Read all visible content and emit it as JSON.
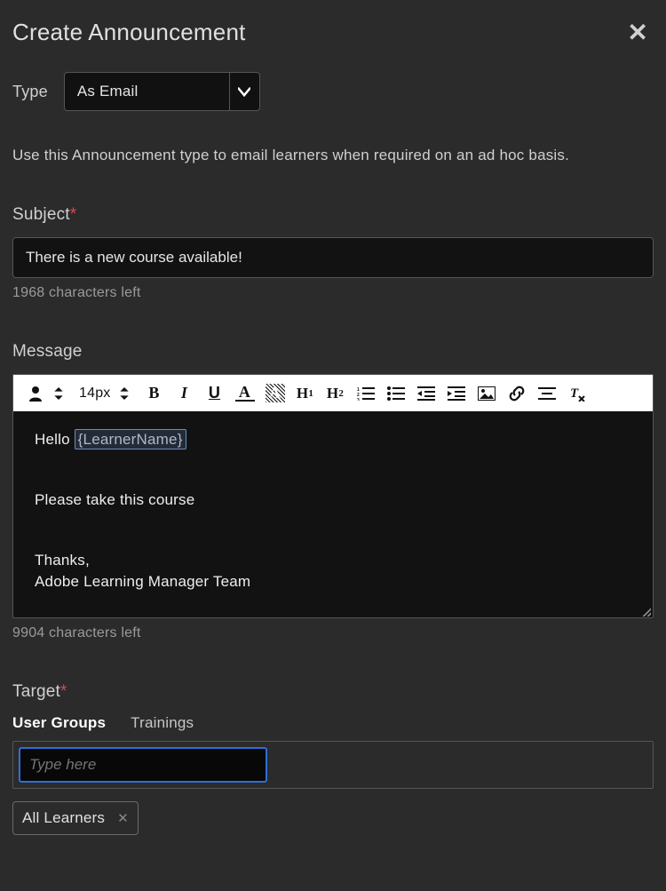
{
  "header": {
    "title": "Create Announcement"
  },
  "type": {
    "label": "Type",
    "selected": "As Email"
  },
  "helper": "Use this Announcement type to email learners when required on an ad hoc basis.",
  "subject": {
    "label": "Subject",
    "value": "There is a new course available!",
    "chars_left": "1968 characters left"
  },
  "message": {
    "label": "Message",
    "toolbar": {
      "font_size": "14px",
      "h1": "H1",
      "h2": "H2"
    },
    "body": {
      "greeting_prefix": "Hello ",
      "token": "{LearnerName}",
      "line2": "Please take this course",
      "line3": "Thanks,",
      "line4": "Adobe Learning Manager Team"
    },
    "chars_left": "9904 characters left"
  },
  "target": {
    "label": "Target",
    "tabs": {
      "groups": "User Groups",
      "trainings": "Trainings"
    },
    "placeholder": "Type here",
    "chip": "All Learners"
  }
}
